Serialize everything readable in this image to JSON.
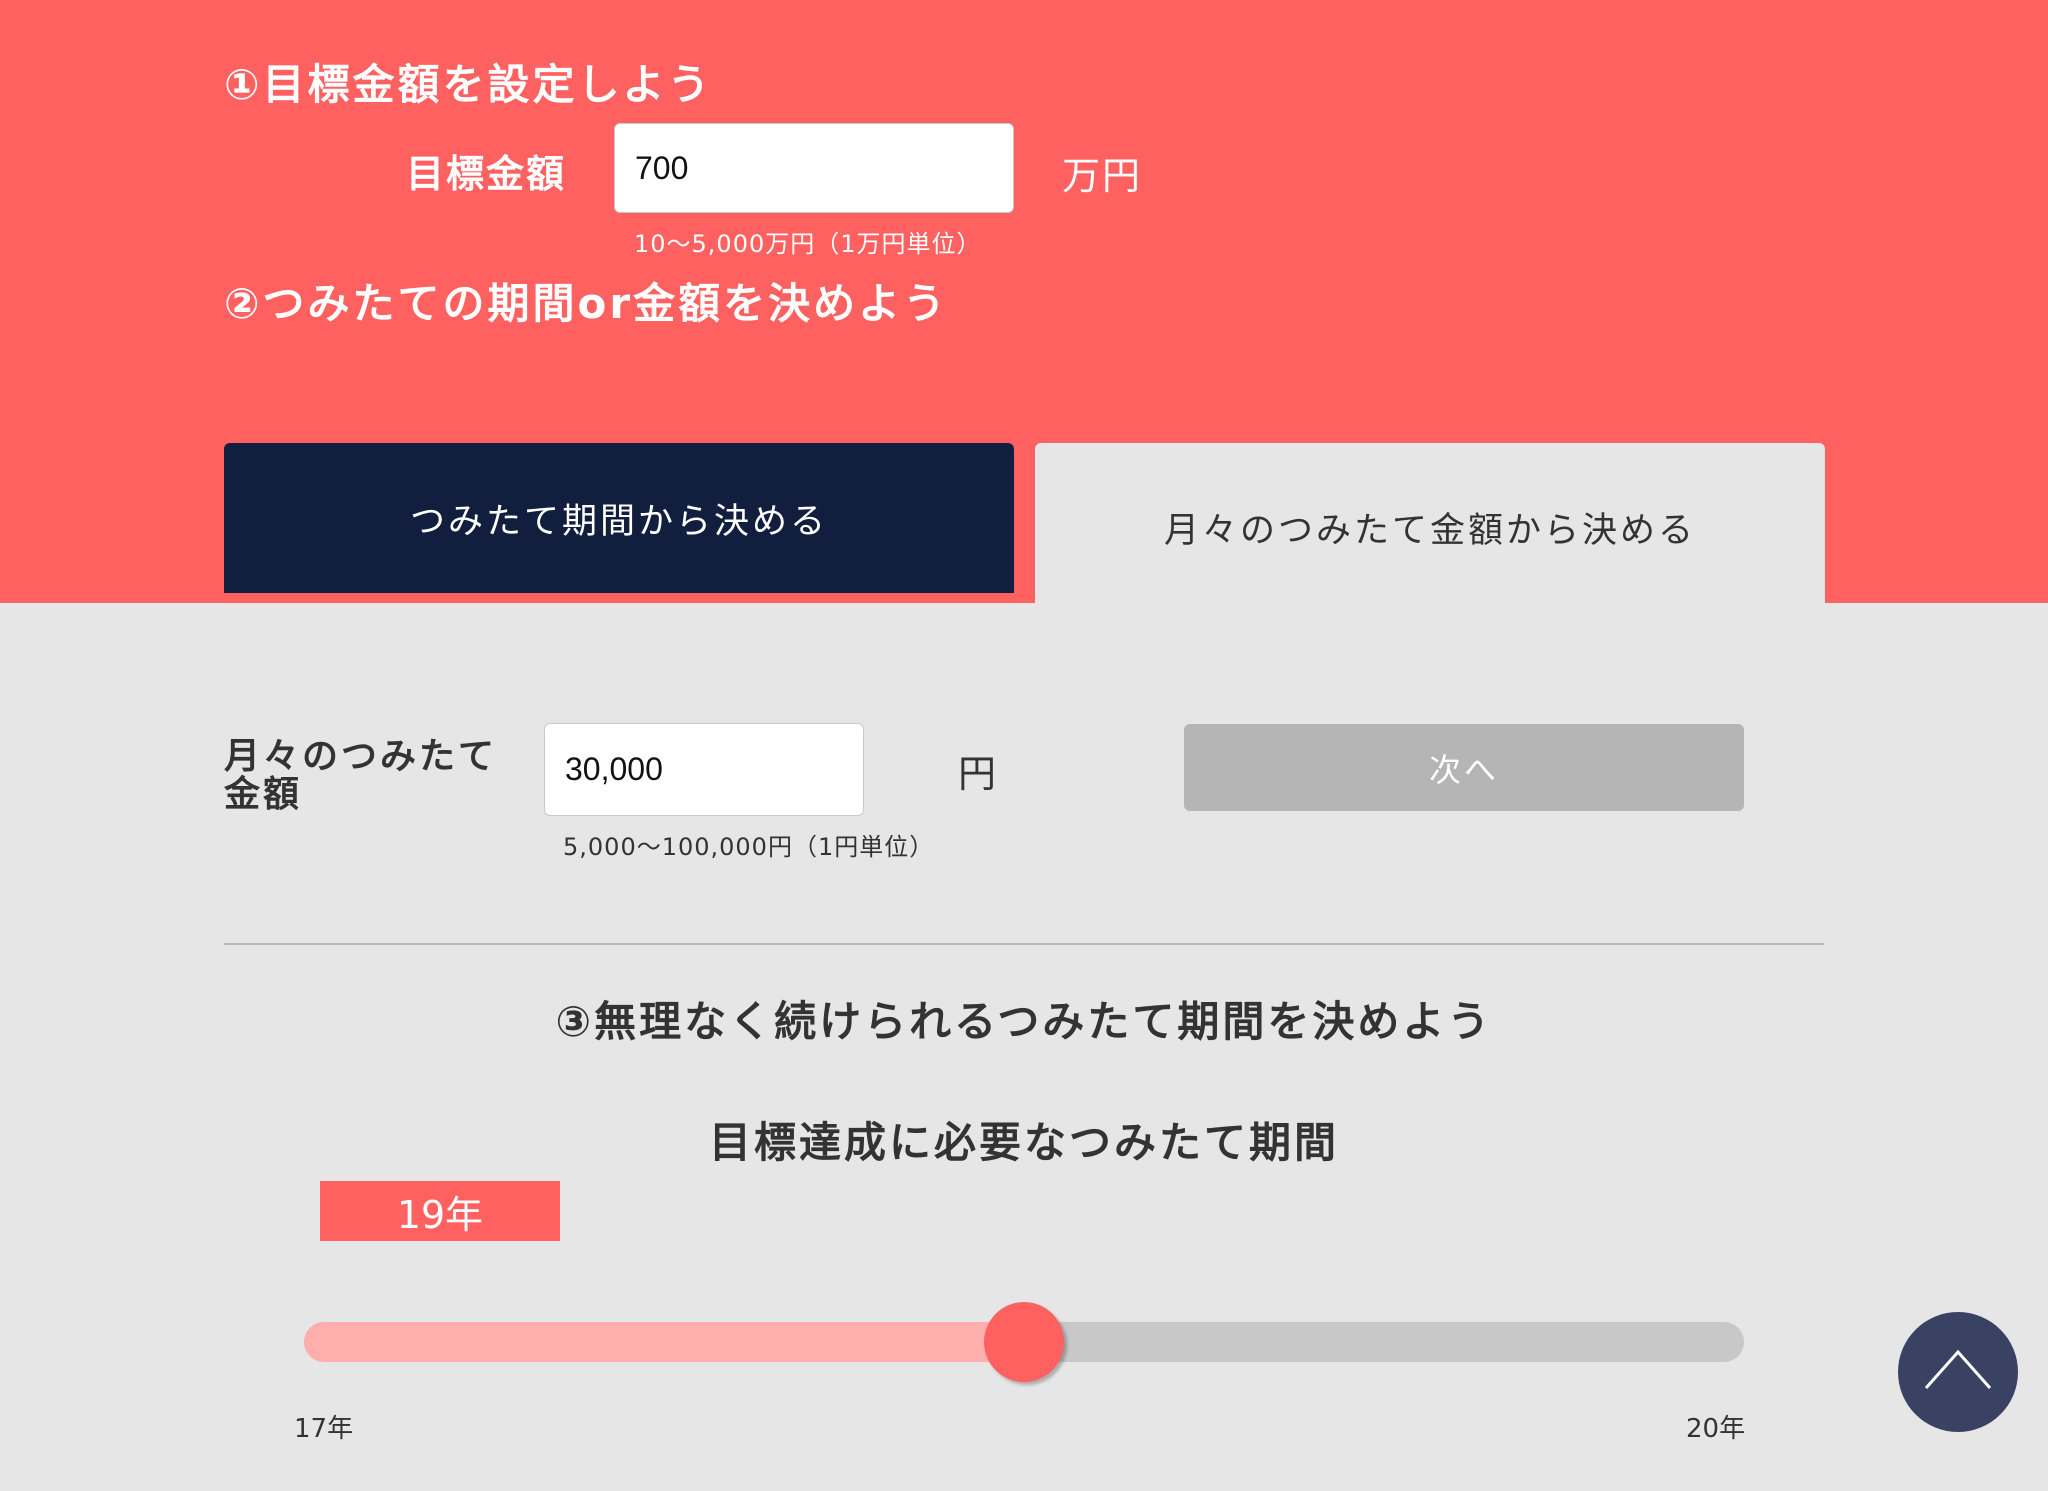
{
  "step1": {
    "title": "①目標金額を設定しよう",
    "target_label": "目標金額",
    "target_value": "700",
    "target_unit": "万円",
    "target_hint": "10〜5,000万円（1万円単位）"
  },
  "step2": {
    "title": "②つみたての期間or金額を決めよう",
    "tabs": [
      {
        "label": "つみたて期間から決める",
        "active": true
      },
      {
        "label": "月々のつみたて金額から決める",
        "active": false
      }
    ],
    "monthly_label_line1": "月々のつみたて",
    "monthly_label_line2": "金額",
    "monthly_value": "30,000",
    "monthly_unit": "円",
    "monthly_hint": "5,000〜100,000円（1円単位）",
    "next_button": "次へ"
  },
  "step3": {
    "title": "③無理なく続けられるつみたて期間を決めよう",
    "subtitle": "目標達成に必要なつみたて期間",
    "slider": {
      "value_label": "19年",
      "min_label": "17年",
      "max_label": "20年",
      "min": 17,
      "max": 20,
      "value": 19
    }
  },
  "colors": {
    "accent": "#ff6060",
    "navy": "#121e3e",
    "background": "#e6e6e7",
    "button_disabled": "#b5b5b5",
    "slider_fill": "#ffaeae",
    "slider_track": "#c8c8c8",
    "back_to_top": "#3a4263"
  },
  "icons": {
    "back_to_top": "chevron-up-icon"
  }
}
